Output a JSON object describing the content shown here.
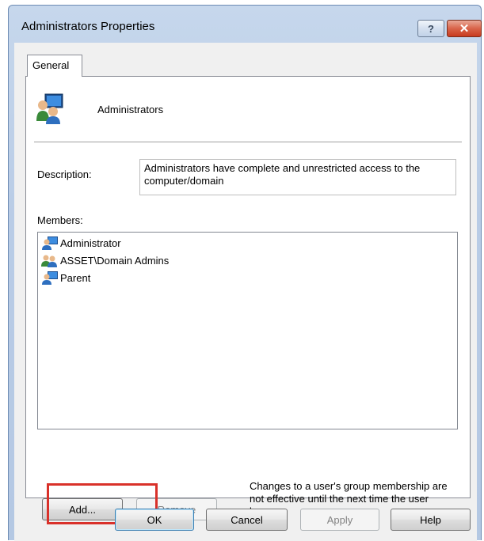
{
  "window": {
    "title": "Administrators Properties",
    "help_glyph": "?",
    "close_glyph": "✕"
  },
  "tabs": [
    {
      "label": "General"
    }
  ],
  "group": {
    "icon": "group-users-icon",
    "name": "Administrators"
  },
  "description": {
    "label": "Description:",
    "value": "Administrators have complete and unrestricted access to the computer/domain"
  },
  "members": {
    "label": "Members:",
    "items": [
      {
        "name": "Administrator",
        "icon": "user-icon"
      },
      {
        "name": "ASSET\\Domain Admins",
        "icon": "group-icon"
      },
      {
        "name": "Parent",
        "icon": "user-icon"
      }
    ]
  },
  "buttons": {
    "add": "Add...",
    "remove": "Remove",
    "ok": "OK",
    "cancel": "Cancel",
    "apply": "Apply",
    "help": "Help"
  },
  "note": "Changes to a user's group membership are not effective until the next time the user logs on.",
  "colors": {
    "highlight": "#d9312a",
    "titlebar": "#b9cce6"
  }
}
